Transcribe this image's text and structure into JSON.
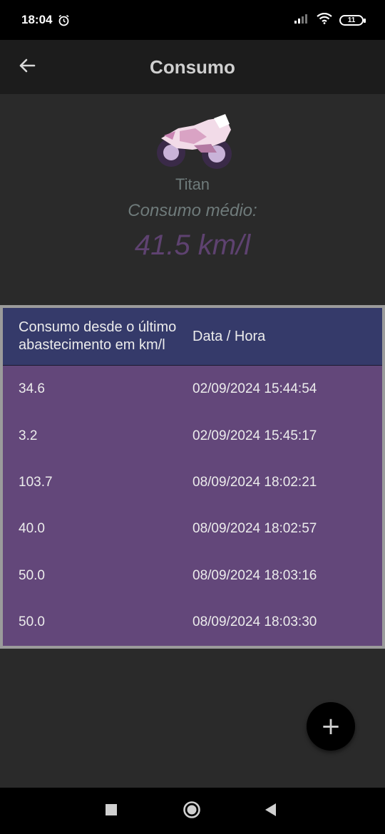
{
  "status_bar": {
    "time": "18:04",
    "battery": "11"
  },
  "app_bar": {
    "title": "Consumo"
  },
  "summary": {
    "bike_name": "Titan",
    "average_label": "Consumo médio:",
    "average_value": "41.5 km/l"
  },
  "table": {
    "headers": [
      "Consumo desde o último abastecimento em km/l",
      "Data / Hora"
    ],
    "rows": [
      [
        "34.6",
        "02/09/2024 15:44:54"
      ],
      [
        "3.2",
        "02/09/2024 15:45:17"
      ],
      [
        "103.7",
        "08/09/2024 18:02:21"
      ],
      [
        "40.0",
        "08/09/2024 18:02:57"
      ],
      [
        "50.0",
        "08/09/2024 18:03:16"
      ],
      [
        "50.0",
        "08/09/2024 18:03:30"
      ]
    ]
  },
  "fab": {
    "icon": "plus-icon",
    "label": "+"
  },
  "colors": {
    "table_header": "#353a6a",
    "table_body": "#63477a",
    "average_value": "#5e4270"
  }
}
